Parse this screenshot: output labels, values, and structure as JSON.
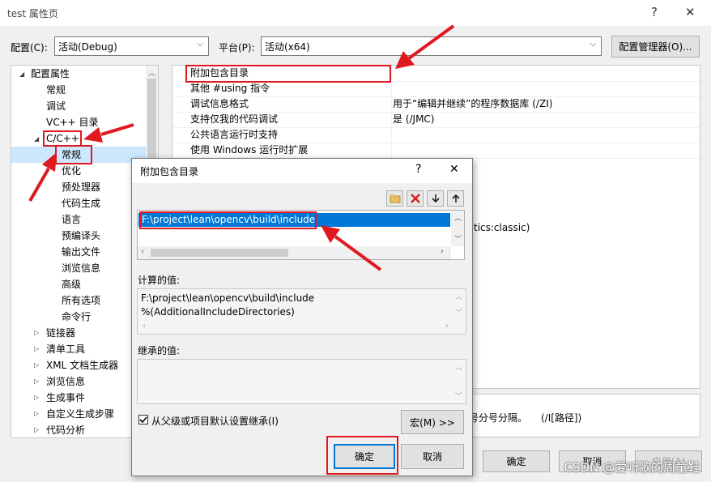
{
  "window": {
    "title": "test 属性页",
    "help_glyph": "?",
    "close_glyph": "✕"
  },
  "toolbar": {
    "config_label": "配置(C):",
    "config_value": "活动(Debug)",
    "platform_label": "平台(P):",
    "platform_value": "活动(x64)",
    "config_manager_label": "配置管理器(O)..."
  },
  "tree": {
    "root": "配置属性",
    "general": "常规",
    "debugging": "调试",
    "vcpp_dirs": "VC++ 目录",
    "cpp": "C/C++",
    "cpp_children": [
      "常规",
      "优化",
      "预处理器",
      "代码生成",
      "语言",
      "预编译头",
      "输出文件",
      "浏览信息",
      "高级",
      "所有选项",
      "命令行"
    ],
    "others": [
      "链接器",
      "清单工具",
      "XML 文档生成器",
      "浏览信息",
      "生成事件",
      "自定义生成步骤",
      "代码分析"
    ]
  },
  "properties": [
    {
      "name": "附加包含目录",
      "value": ""
    },
    {
      "name": "其他 #using 指令",
      "value": ""
    },
    {
      "name": "调试信息格式",
      "value": "用于“编辑并继续”的程序数据库 (/ZI)"
    },
    {
      "name": "支持仅我的代码调试",
      "value": "是 (/JMC)"
    },
    {
      "name": "公共语言运行时支持",
      "value": ""
    },
    {
      "name": "使用 Windows 运行时扩展",
      "value": ""
    }
  ],
  "partial_texts": {
    "diag_value": "tics:classic)",
    "desc_text": "号分号分隔。",
    "desc_switch": "(/I[路径])"
  },
  "footer": {
    "ok": "确定",
    "cancel": "取消",
    "apply": "应用(A)"
  },
  "dialog": {
    "title": "附加包含目录",
    "help_glyph": "?",
    "close_glyph": "✕",
    "entries": [
      "F:\\project\\lean\\opencv\\build\\include"
    ],
    "computed_label": "计算的值:",
    "computed_values": [
      "F:\\project\\lean\\opencv\\build\\include",
      "%(AdditionalIncludeDirectories)"
    ],
    "inherited_label": "继承的值:",
    "inherit_checkbox_label": "从父级或项目默认设置继承(I)",
    "inherit_checked": true,
    "macros_label": "宏(M) >>",
    "ok": "确定",
    "cancel": "取消"
  },
  "watermark": "CSDN @爱听歌的周童鞋",
  "colors": {
    "annotation_red": "#e0181f",
    "selection": "#0078d7",
    "tree_selected": "#cce8ff"
  }
}
